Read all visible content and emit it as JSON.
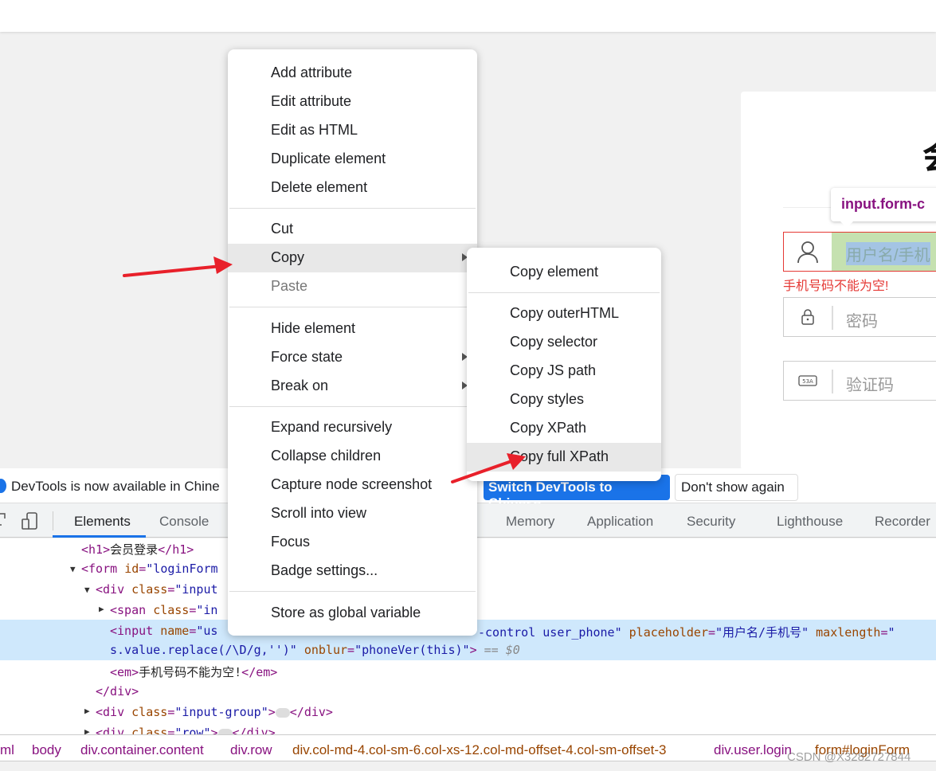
{
  "page": {
    "title_char": "会",
    "tooltip": "input.form-c",
    "username_placeholder": "用户名/手机号",
    "username_visible": "用户名/手机",
    "error": "手机号码不能为空!",
    "password_placeholder": "密码",
    "captcha_placeholder": "验证码"
  },
  "infobar": {
    "text": "DevTools is now available in Chine",
    "switch": "Switch DevTools to Chinese",
    "dont_show": "Don't show again"
  },
  "tabs": [
    "Elements",
    "Console",
    "Memory",
    "Application",
    "Security",
    "Lighthouse",
    "Recorder"
  ],
  "tree": {
    "l1": "<h1>",
    "l1t": "会员登录",
    "l1e": "</h1>",
    "l2": "<form ",
    "l2a": "id",
    "l2v": "\"loginForm",
    "l3": "<div ",
    "l3a": "class",
    "l3v": "\"input",
    "l4": "<span ",
    "l4a": "class",
    "l4v": "\"in",
    "l5a": "<input ",
    "l5b": "name",
    "l5c": "\"us",
    "l5d": "-control user_phone\"",
    "l5e": "placeholder",
    "l5f": "\"用户名/手机号\"",
    "l5g": "maxlength",
    "l5h": "\"",
    "l6a": "s.value.replace(/\\D/g,'')\"",
    "l6b": "onblur",
    "l6c": "\"phoneVer(this)\"",
    "l6d": ">",
    "l6e": "== $0",
    "l7a": "<em>",
    "l7b": "手机号码不能为空!",
    "l7c": "</em>",
    "l8": "</div>",
    "l9a": "<div ",
    "l9b": "class",
    "l9c": "\"input-group\"",
    "l9d": ">",
    "l9e": "</div>",
    "l10a": "<div ",
    "l10b": "class",
    "l10c": "\"row\"",
    "l10d": ">",
    "l10e": "</div>"
  },
  "breadcrumbs": [
    "ml",
    "body",
    "div.container.content",
    "div.row",
    "div.col-md-4.col-sm-6.col-xs-12.col-md-offset-4.col-sm-offset-3",
    "div.user.login",
    "form#loginForm"
  ],
  "watermark": "CSDN @X3282727844",
  "context_menu": [
    "Add attribute",
    "Edit attribute",
    "Edit as HTML",
    "Duplicate element",
    "Delete element",
    "Cut",
    "Copy",
    "Paste",
    "Hide element",
    "Force state",
    "Break on",
    "Expand recursively",
    "Collapse children",
    "Capture node screenshot",
    "Scroll into view",
    "Focus",
    "Badge settings...",
    "Store as global variable"
  ],
  "copy_submenu": [
    "Copy element",
    "Copy outerHTML",
    "Copy selector",
    "Copy JS path",
    "Copy styles",
    "Copy XPath",
    "Copy full XPath"
  ],
  "colors": {
    "accent": "#1a73e8",
    "error": "#e53935",
    "arrow": "#e8202a",
    "selection": "#cfe8fc"
  }
}
